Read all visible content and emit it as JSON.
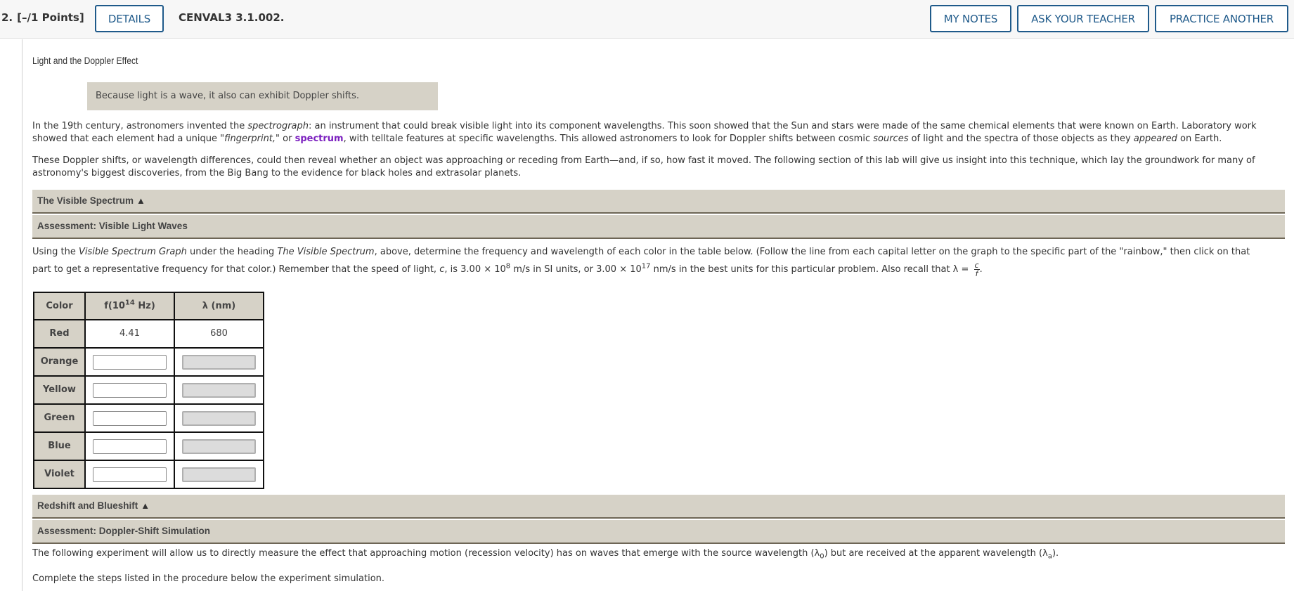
{
  "header": {
    "question_number": "2.",
    "points": "[–/1 Points]",
    "details_label": "DETAILS",
    "question_id": "CENVAL3 3.1.002.",
    "my_notes_label": "MY NOTES",
    "ask_teacher_label": "ASK YOUR TEACHER",
    "practice_another_label": "PRACTICE ANOTHER"
  },
  "lab": {
    "title": "Light and the Doppler Effect",
    "callout": "Because light is a wave, it also can exhibit Doppler shifts.",
    "para1": {
      "a": "In the 19th century, astronomers invented the ",
      "spectrograph": "spectrograph",
      "b": ": an instrument that could break visible light into its component wavelengths. This soon showed that the Sun and stars were made of the same chemical elements that were known on Earth. Laboratory work showed that each element had a unique \"",
      "fingerprint": "fingerprint,",
      "c": "\" or ",
      "spectrum_link": "spectrum",
      "d": ", with telltale features at specific wavelengths. This allowed astronomers to look for Doppler shifts between cosmic ",
      "sources": "sources",
      "e": " of light and the spectra of those objects as they ",
      "appeared": "appeared",
      "f": " on Earth."
    },
    "para2": "These Doppler shifts, or wavelength differences, could then reveal whether an object was approaching or receding from Earth—and, if so, how fast it moved. The following section of this lab will give us insight into this technique, which lay the groundwork for many of astronomy's biggest discoveries, from the Big Bang to the evidence for black holes and extrasolar planets."
  },
  "sections": {
    "visible_spectrum": "The Visible Spectrum",
    "assessment_visible": "Assessment: Visible Light Waves",
    "redshift": "Redshift and Blueshift",
    "assessment_doppler": "Assessment: Doppler-Shift Simulation",
    "toggle_glyph": "▲"
  },
  "instructions": {
    "a": "Using the ",
    "graph": "Visible Spectrum Graph",
    "b": " under the heading ",
    "heading": "The Visible Spectrum",
    "c": ", above, determine the frequency and wavelength of each color in the table below. (Follow the line from each capital letter on the graph to the specific part of the \"rainbow,\" then click on that part to get a representative frequency for that color.) Remember that the speed of light, ",
    "c_var": "c",
    "d": ", is 3.00 × 10",
    "exp1": "8",
    "e": " m/s in SI units, or 3.00 × 10",
    "exp2": "17",
    "f": " nm/s in the best units for this particular problem. Also recall that λ = ",
    "frac_num": "c",
    "frac_den": "f",
    "g": "."
  },
  "table": {
    "headers": {
      "color": "Color",
      "freq_prefix": "f(10",
      "freq_exp": "14",
      "freq_suffix": " Hz)",
      "wavelength": "λ (nm)"
    },
    "rows": [
      {
        "color": "Red",
        "frequency": "4.41",
        "wavelength": "680"
      },
      {
        "color": "Orange",
        "frequency": "",
        "wavelength": ""
      },
      {
        "color": "Yellow",
        "frequency": "",
        "wavelength": ""
      },
      {
        "color": "Green",
        "frequency": "",
        "wavelength": ""
      },
      {
        "color": "Blue",
        "frequency": "",
        "wavelength": ""
      },
      {
        "color": "Violet",
        "frequency": "",
        "wavelength": ""
      }
    ]
  },
  "doppler": {
    "para_a": "The following experiment will allow us to directly measure the effect that approaching motion (recession velocity) has on waves that emerge with the source wavelength (λ",
    "sub0": "0",
    "para_b": ") but are received at the apparent wavelength (λ",
    "suba": "a",
    "para_c": ").",
    "steps": "Complete the steps listed in the procedure below the experiment simulation."
  },
  "colors": {
    "accent": "#1f5a8a",
    "section_bg": "#d6d2c7",
    "link_purple": "#7b1fbf"
  }
}
